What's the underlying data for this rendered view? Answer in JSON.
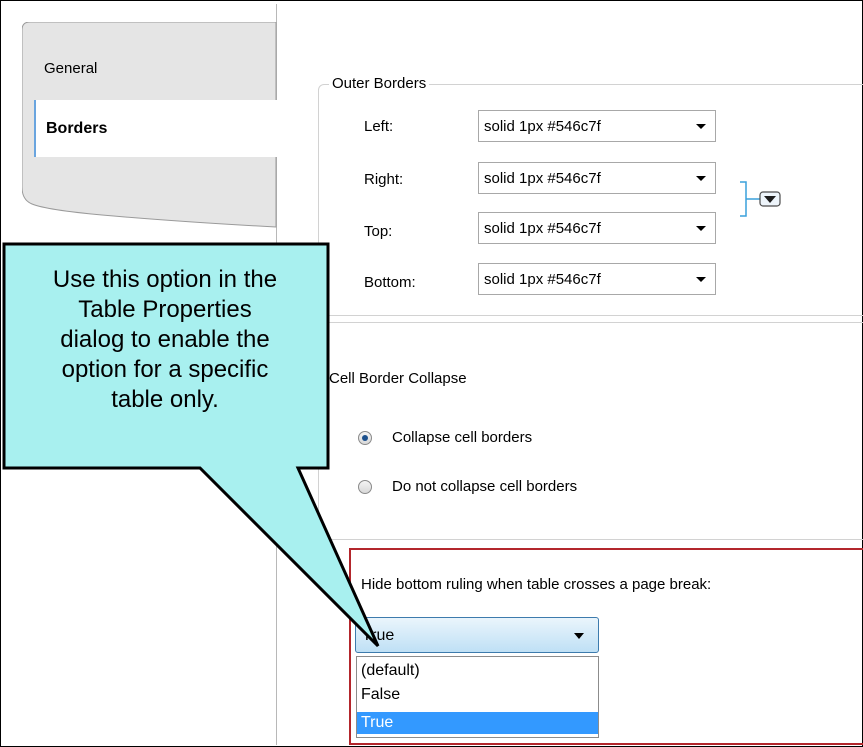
{
  "sidebar": {
    "tabs": [
      {
        "label": "General"
      },
      {
        "label": "Borders"
      }
    ]
  },
  "outer_borders": {
    "title": "Outer Borders",
    "rows": [
      {
        "label": "Left:",
        "value": "solid 1px #546c7f"
      },
      {
        "label": "Right:",
        "value": "solid 1px #546c7f"
      },
      {
        "label": "Top:",
        "value": "solid 1px #546c7f"
      },
      {
        "label": "Bottom:",
        "value": "solid 1px #546c7f"
      }
    ]
  },
  "cell_border_collapse": {
    "title": "Cell Border Collapse",
    "options": [
      {
        "label": "Collapse cell borders",
        "checked": true
      },
      {
        "label": "Do not collapse cell borders",
        "checked": false
      }
    ]
  },
  "hide_ruling": {
    "label": "Hide bottom ruling when table crosses a page break:",
    "selected": "True",
    "options": [
      "(default)",
      "False",
      "True"
    ]
  },
  "callout": {
    "lines": [
      "Use this option in the",
      "Table Properties",
      "dialog to enable the",
      "option for a specific",
      "table only."
    ],
    "fill_color": "#a8f0ef"
  },
  "colors": {
    "highlight": "#b3262c",
    "selection": "#3399ff",
    "tab_accent": "#6aa5df"
  }
}
